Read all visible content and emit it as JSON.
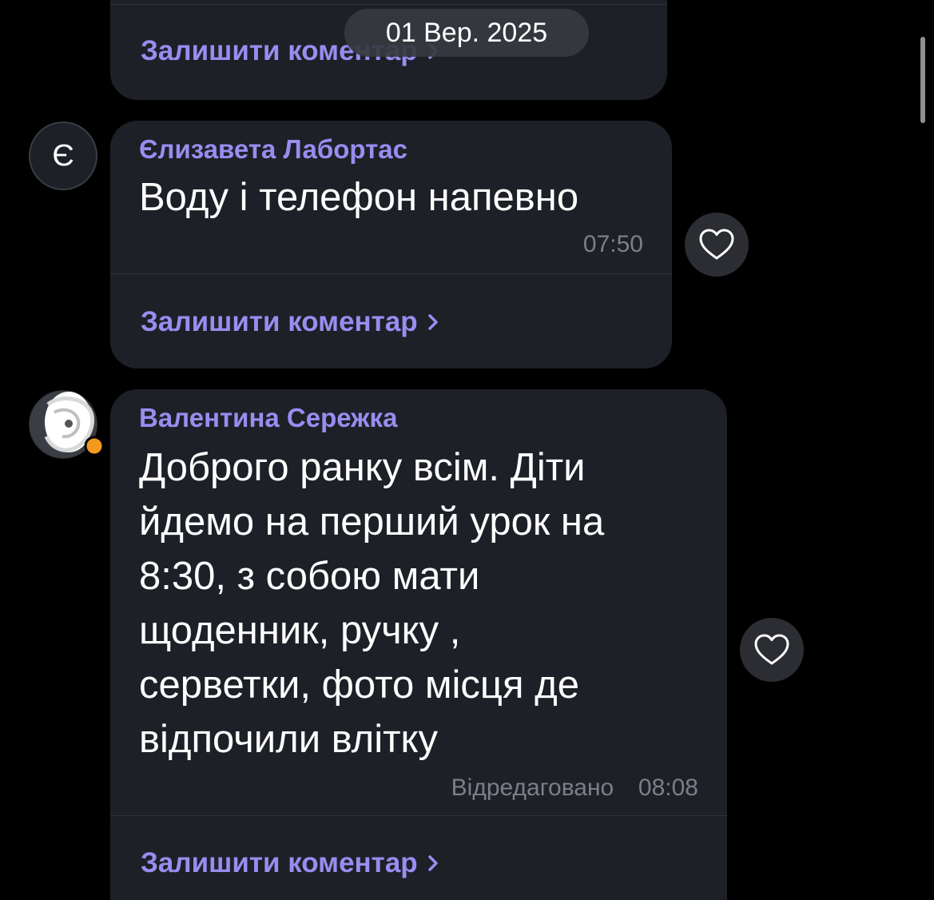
{
  "date_badge": "01 Вер. 2025",
  "messages": [
    {
      "comment_label": "Залишити коментар"
    },
    {
      "avatar_letter": "Є",
      "sender": "Єлизавета Лабортас",
      "lines": [
        "Воду і телефон напевно"
      ],
      "time": "07:50",
      "comment_label": "Залишити коментар"
    },
    {
      "sender": "Валентина Сережка",
      "lines": [
        "Доброго ранку всім. Діти",
        "йдемо на перший урок на",
        "8:30, з собою мати",
        "щоденник, ручку ,",
        "серветки, фото місця де",
        "відпочили влітку"
      ],
      "edited_label": "Відредаговано",
      "time": "08:08",
      "comment_label": "Залишити коментар"
    }
  ],
  "colors": {
    "background": "#000000",
    "bubble": "#1e2027",
    "accent": "#9a8cf0",
    "meta": "#7b7f88",
    "status_dot": "#f29a1f"
  },
  "icons": {
    "like": "heart-outline-icon",
    "chevron": "chevron-right-icon"
  }
}
